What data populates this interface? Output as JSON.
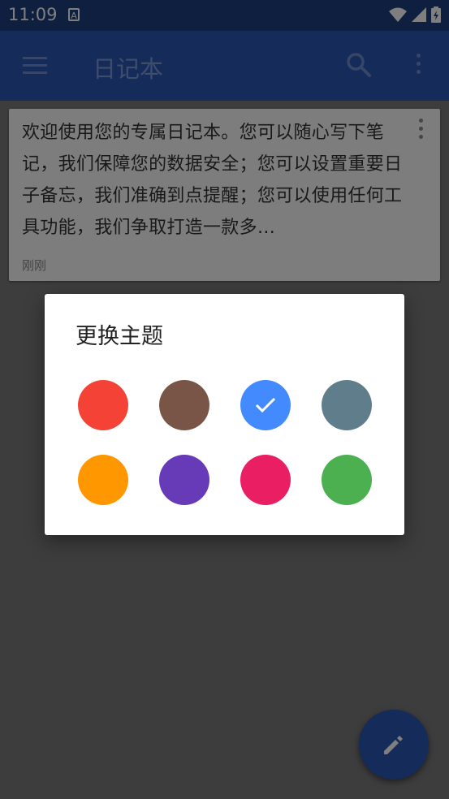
{
  "status_bar": {
    "time": "11:09",
    "notification_icon": "keyboard-a-icon",
    "icons": [
      "wifi-icon",
      "signal-icon",
      "battery-charging-icon"
    ]
  },
  "app_bar": {
    "title": "日记本",
    "left_icon": "menu-icon",
    "right_icons": [
      "search-icon",
      "more-vert-icon"
    ]
  },
  "note": {
    "text": "欢迎使用您的专属日记本。您可以随心写下笔记，我们保障您的数据安全；您可以设置重要日子备忘，我们准确到点提醒；您可以使用任何工具功能，我们争取打造一款多…",
    "time": "刚刚"
  },
  "dialog": {
    "title": "更换主题",
    "colors": [
      "#f44336",
      "#795548",
      "#448aff",
      "#607d8b",
      "#ff9800",
      "#673ab7",
      "#e91e63",
      "#4caf50"
    ],
    "selected_index": 2
  },
  "fab": {
    "icon": "edit-icon"
  }
}
